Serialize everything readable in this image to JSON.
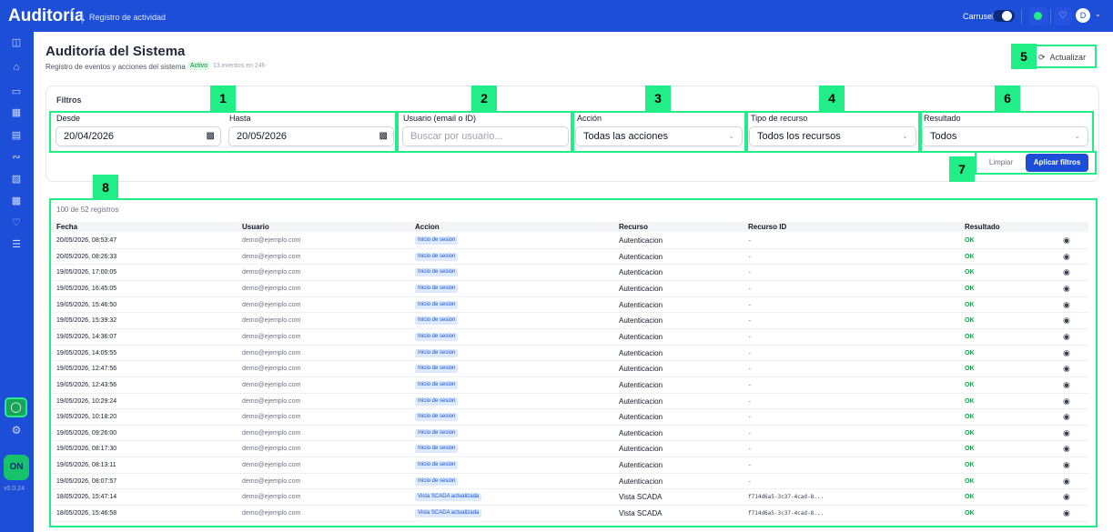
{
  "header": {
    "brand": "Auditoría",
    "subtitle": "Registro de actividad",
    "carrusel_label": "Carrusel",
    "avatar_initial": "D",
    "colors": {
      "primary": "#1d4ed8",
      "highlight": "#22ee88"
    }
  },
  "sidebar": {
    "version": "v0.0.24",
    "on_label": "ON",
    "icons": [
      "grid-icon",
      "home-icon",
      "monitor-icon",
      "widgets-icon",
      "document-icon",
      "route-icon",
      "clipboard-icon",
      "calendar-icon",
      "bell-icon",
      "database-icon"
    ]
  },
  "page": {
    "title": "Auditoría del Sistema",
    "description": "Registro de eventos y acciones del sistema",
    "status_badge": "Activo",
    "events_summary": "13 eventos en 24h",
    "refresh_label": "Actualizar"
  },
  "filters": {
    "title": "Filtros",
    "desde_label": "Desde",
    "desde_value": "20/04/2026",
    "hasta_label": "Hasta",
    "hasta_value": "20/05/2026",
    "usuario_label": "Usuario (email o ID)",
    "usuario_placeholder": "Buscar por usuario...",
    "accion_label": "Acción",
    "accion_value": "Todas las acciones",
    "tipo_label": "Tipo de recurso",
    "tipo_value": "Todos los recursos",
    "resultado_label": "Resultado",
    "resultado_value": "Todos",
    "clear_label": "Limpiar",
    "apply_label": "Aplicar filtros"
  },
  "annotations": [
    "1",
    "2",
    "3",
    "4",
    "5",
    "6",
    "7",
    "8"
  ],
  "table": {
    "count_text": "100 de 52 registros",
    "headers": [
      "Fecha",
      "Usuario",
      "Accion",
      "Recurso",
      "Recurso ID",
      "Resultado"
    ],
    "rows": [
      {
        "fecha": "20/05/2026, 08:53:47",
        "usuario": "demo@ejemplo.com",
        "accion": "Inicio de sesion",
        "recurso": "Autenticacion",
        "recurso_id": "-",
        "resultado": "OK"
      },
      {
        "fecha": "20/05/2026, 08:26:33",
        "usuario": "demo@ejemplo.com",
        "accion": "Inicio de sesion",
        "recurso": "Autenticacion",
        "recurso_id": "-",
        "resultado": "OK"
      },
      {
        "fecha": "19/05/2026, 17:00:05",
        "usuario": "demo@ejemplo.com",
        "accion": "Inicio de sesion",
        "recurso": "Autenticacion",
        "recurso_id": "-",
        "resultado": "OK"
      },
      {
        "fecha": "19/05/2026, 16:45:05",
        "usuario": "demo@ejemplo.com",
        "accion": "Inicio de sesion",
        "recurso": "Autenticacion",
        "recurso_id": "-",
        "resultado": "OK"
      },
      {
        "fecha": "19/05/2026, 15:46:50",
        "usuario": "demo@ejemplo.com",
        "accion": "Inicio de sesion",
        "recurso": "Autenticacion",
        "recurso_id": "-",
        "resultado": "OK"
      },
      {
        "fecha": "19/05/2026, 15:39:32",
        "usuario": "demo@ejemplo.com",
        "accion": "Inicio de sesion",
        "recurso": "Autenticacion",
        "recurso_id": "-",
        "resultado": "OK"
      },
      {
        "fecha": "19/05/2026, 14:36:07",
        "usuario": "demo@ejemplo.com",
        "accion": "Inicio de sesion",
        "recurso": "Autenticacion",
        "recurso_id": "-",
        "resultado": "OK"
      },
      {
        "fecha": "19/05/2026, 14:05:55",
        "usuario": "demo@ejemplo.com",
        "accion": "Inicio de sesion",
        "recurso": "Autenticacion",
        "recurso_id": "-",
        "resultado": "OK"
      },
      {
        "fecha": "19/05/2026, 12:47:56",
        "usuario": "demo@ejemplo.com",
        "accion": "Inicio de sesion",
        "recurso": "Autenticacion",
        "recurso_id": "-",
        "resultado": "OK"
      },
      {
        "fecha": "19/05/2026, 12:43:56",
        "usuario": "demo@ejemplo.com",
        "accion": "Inicio de sesion",
        "recurso": "Autenticacion",
        "recurso_id": "-",
        "resultado": "OK"
      },
      {
        "fecha": "19/05/2026, 10:29:24",
        "usuario": "demo@ejemplo.com",
        "accion": "Inicio de sesion",
        "recurso": "Autenticacion",
        "recurso_id": "-",
        "resultado": "OK"
      },
      {
        "fecha": "19/05/2026, 10:18:20",
        "usuario": "demo@ejemplo.com",
        "accion": "Inicio de sesion",
        "recurso": "Autenticacion",
        "recurso_id": "-",
        "resultado": "OK"
      },
      {
        "fecha": "19/05/2026, 09:26:00",
        "usuario": "demo@ejemplo.com",
        "accion": "Inicio de sesion",
        "recurso": "Autenticacion",
        "recurso_id": "-",
        "resultado": "OK"
      },
      {
        "fecha": "19/05/2026, 08:17:30",
        "usuario": "demo@ejemplo.com",
        "accion": "Inicio de sesion",
        "recurso": "Autenticacion",
        "recurso_id": "-",
        "resultado": "OK"
      },
      {
        "fecha": "19/05/2026, 08:13:11",
        "usuario": "demo@ejemplo.com",
        "accion": "Inicio de sesion",
        "recurso": "Autenticacion",
        "recurso_id": "-",
        "resultado": "OK"
      },
      {
        "fecha": "19/05/2026, 08:07:57",
        "usuario": "demo@ejemplo.com",
        "accion": "Inicio de sesion",
        "recurso": "Autenticacion",
        "recurso_id": "-",
        "resultado": "OK"
      },
      {
        "fecha": "18/05/2026, 15:47:14",
        "usuario": "demo@ejemplo.com",
        "accion": "Vista SCADA actualizada",
        "recurso": "Vista SCADA",
        "recurso_id": "f714d6a5-3c37-4cad-8...",
        "resultado": "OK"
      },
      {
        "fecha": "18/05/2026, 15:46:58",
        "usuario": "demo@ejemplo.com",
        "accion": "Vista SCADA actualizada",
        "recurso": "Vista SCADA",
        "recurso_id": "f714d6a5-3c37-4cad-8...",
        "resultado": "OK"
      }
    ]
  }
}
